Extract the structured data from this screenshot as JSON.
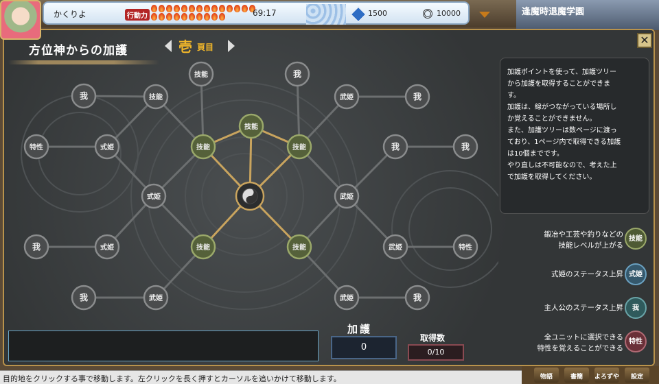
{
  "topbar": {
    "player_name": "かくりよ",
    "ap_label": "行動力",
    "ap_time": "69:17",
    "jewels": "1500",
    "coins": "10000",
    "area_name": "逢魔時退魔学園"
  },
  "panel": {
    "title": "方位神からの加護",
    "page_number": "壱",
    "page_unit": "頁目",
    "close": "✕"
  },
  "info": [
    "加護ポイントを使って、加護ツリー",
    "から加護を取得することができま",
    "す。",
    "加護は、線がつながっている場所し",
    "か覚えることができません。",
    "また、加護ツリーは数ページに渡っ",
    "ており、1ページ内で取得できる加護",
    "は10個までです。",
    "やり直しは不可能なので、考えた上",
    "で加護を取得してください。"
  ],
  "legend": [
    {
      "line1": "鍛冶や工芸や釣りなどの",
      "line2": "技能レベルが上がる",
      "node": "技能",
      "color": "#4e5a34"
    },
    {
      "line1": "式姫のステータス上昇",
      "line2": "",
      "node": "式姫",
      "color": "#35586c"
    },
    {
      "line1": "主人公のステータス上昇",
      "line2": "",
      "node": "我",
      "color": "#2f5a5c"
    },
    {
      "line1": "全ユニットに選択できる",
      "line2": "特性を覚えることができる",
      "node": "特性",
      "color": "#6a3038"
    }
  ],
  "kago": {
    "label": "加護",
    "value": "0"
  },
  "acquired": {
    "label": "取得数",
    "value": "0/10"
  },
  "tree": {
    "nodes": [
      {
        "label": "我",
        "type": "gray"
      },
      {
        "label": "技能",
        "type": "gray"
      },
      {
        "label": "我",
        "type": "gray"
      },
      {
        "label": "技能",
        "type": "gray"
      },
      {
        "label": "武姫",
        "type": "gray"
      },
      {
        "label": "我",
        "type": "gray"
      },
      {
        "label": "技能",
        "type": "green"
      },
      {
        "label": "特性",
        "type": "gray"
      },
      {
        "label": "式姫",
        "type": "gray"
      },
      {
        "label": "技能",
        "type": "green"
      },
      {
        "label": "技能",
        "type": "green"
      },
      {
        "label": "我",
        "type": "gray"
      },
      {
        "label": "我",
        "type": "gray"
      },
      {
        "label": "式姫",
        "type": "gray"
      },
      {
        "label": "",
        "type": "center"
      },
      {
        "label": "武姫",
        "type": "gray"
      },
      {
        "label": "我",
        "type": "gray"
      },
      {
        "label": "式姫",
        "type": "gray"
      },
      {
        "label": "技能",
        "type": "green"
      },
      {
        "label": "技能",
        "type": "green"
      },
      {
        "label": "武姫",
        "type": "gray"
      },
      {
        "label": "特性",
        "type": "gray"
      },
      {
        "label": "我",
        "type": "gray"
      },
      {
        "label": "武姫",
        "type": "gray"
      },
      {
        "label": "武姫",
        "type": "gray"
      },
      {
        "label": "我",
        "type": "gray"
      }
    ]
  },
  "status_message": "目的地をクリックする事で移動します。左クリックを長く押すとカーソルを追いかけて移動します。",
  "bottom_buttons": [
    "物語",
    "書簡",
    "よろずや",
    "設定"
  ]
}
